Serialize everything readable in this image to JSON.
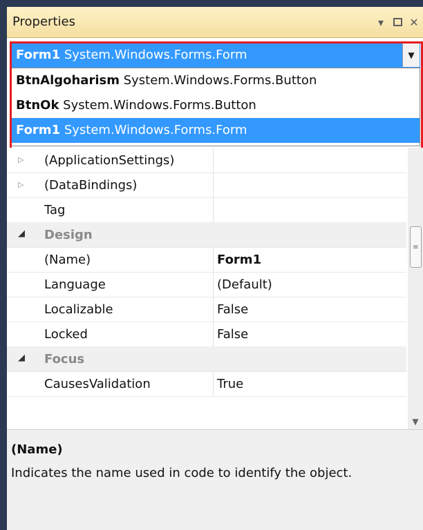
{
  "panel": {
    "title": "Properties",
    "icons": [
      "dropdown-arrow-icon",
      "maximize-icon",
      "close-icon"
    ],
    "accent_color": "#3399ff"
  },
  "selector": {
    "name": "Form1",
    "type": "System.Windows.Forms.Form"
  },
  "dropdown": {
    "items": [
      {
        "name": "BtnAlgoharism",
        "type": "System.Windows.Forms.Button",
        "selected": false
      },
      {
        "name": "BtnOk",
        "type": "System.Windows.Forms.Button",
        "selected": false
      },
      {
        "name": "Form1",
        "type": "System.Windows.Forms.Form",
        "selected": true
      }
    ]
  },
  "grid": {
    "rows": [
      {
        "kind": "property",
        "expandable": true,
        "name": "(ApplicationSettings)",
        "value": ""
      },
      {
        "kind": "property",
        "expandable": true,
        "name": "(DataBindings)",
        "value": ""
      },
      {
        "kind": "property",
        "expandable": false,
        "name": "Tag",
        "value": ""
      },
      {
        "kind": "category",
        "name": "Design"
      },
      {
        "kind": "property",
        "expandable": false,
        "name": "(Name)",
        "value": "Form1",
        "bold": true
      },
      {
        "kind": "property",
        "expandable": false,
        "name": "Language",
        "value": "(Default)"
      },
      {
        "kind": "property",
        "expandable": false,
        "name": "Localizable",
        "value": "False"
      },
      {
        "kind": "property",
        "expandable": false,
        "name": "Locked",
        "value": "False"
      },
      {
        "kind": "category",
        "name": "Focus"
      },
      {
        "kind": "property",
        "expandable": false,
        "name": "CausesValidation",
        "value": "True"
      }
    ]
  },
  "description": {
    "title": "(Name)",
    "text": "Indicates the name used in code to identify the object."
  }
}
